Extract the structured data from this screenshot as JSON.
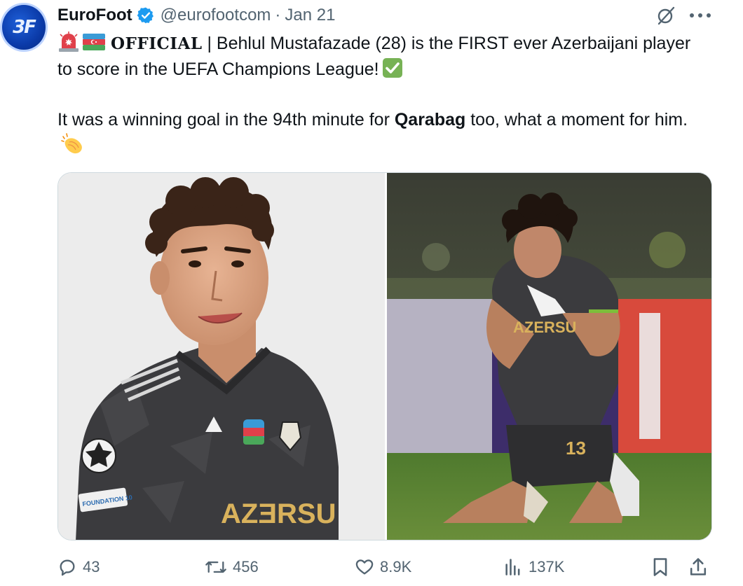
{
  "author": {
    "avatar_text": "3F",
    "display_name": "EuroFoot",
    "handle": "@eurofootcom",
    "separator": "·",
    "date": "Jan 21",
    "verified_color": "#1d9bf0"
  },
  "tweet": {
    "p1_official": "OFFICIAL",
    "p1_text": " | Behlul Mustafazade (28) is the FIRST ever Azerbaijani player to score in the UEFA Champions League!",
    "p2_before": "It was a winning goal in the 94th minute for ",
    "p2_bold": "Qarabag",
    "p2_after": " too, what a moment for him.",
    "emojis": [
      "siren",
      "azerbaijan-flag",
      "check-mark",
      "clapping-hands"
    ]
  },
  "media": {
    "left_shirt_text": "AZƎRSU",
    "left_badge_text": "FOUNDATION 10",
    "right_shirt_text": "AZERSU",
    "right_number": "13"
  },
  "actions": {
    "replies": "43",
    "reposts": "456",
    "likes": "8.9K",
    "views": "137K"
  },
  "colors": {
    "text": "#0f1419",
    "secondary": "#536471",
    "border": "#cfd9de"
  }
}
